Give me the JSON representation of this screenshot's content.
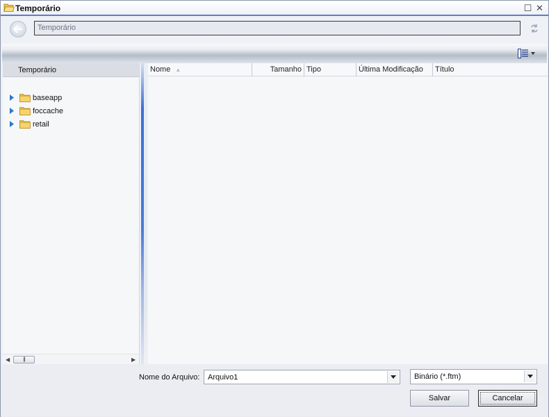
{
  "window": {
    "title": "Temporário",
    "maximize_glyph": "☐",
    "close_glyph": "✕"
  },
  "navigation": {
    "path": "Temporário"
  },
  "tree": {
    "header": "Temporário",
    "items": [
      {
        "label": "baseapp",
        "icon": "folder-icon"
      },
      {
        "label": "foccache",
        "icon": "folder-icon"
      },
      {
        "label": "retail",
        "icon": "folder-icon"
      }
    ]
  },
  "file_list": {
    "columns": [
      "Nome",
      "Tamanho",
      "Tipo",
      "Última Modificação",
      "Título"
    ],
    "sort_indicator": "▲",
    "rows": []
  },
  "footer": {
    "filename_label": "Nome do Arquivo:",
    "filename_value": "Arquivo1",
    "filetype_value": "Binário (*.ftm)",
    "save_label": "Salvar",
    "cancel_label": "Cancelar"
  },
  "colors": {
    "accent": "#3d6fd3",
    "title_border": "#5b7fc1",
    "folder": "#f0c24a"
  }
}
